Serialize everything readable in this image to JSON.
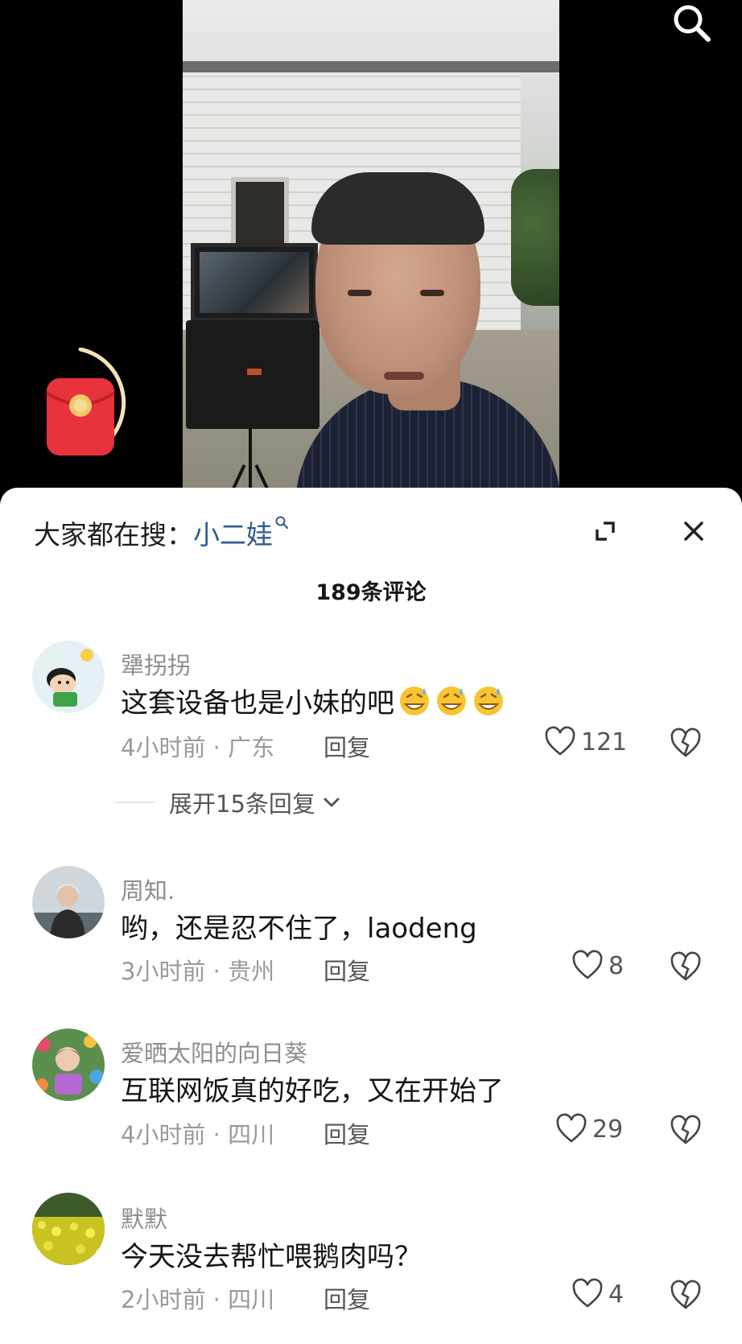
{
  "video": {
    "search_icon": "search-icon",
    "red_packet_icon": "red-packet-icon"
  },
  "sheet": {
    "trend_prefix": "大家都在搜：",
    "trend_term": "小二娃",
    "expand_icon": "expand-icon",
    "close_icon": "close-icon",
    "comment_count": "189条评论"
  },
  "comments": [
    {
      "username": "犟拐拐",
      "text": "这套设备也是小妹的吧",
      "emoji": "sweat-grin-emoji",
      "emoji_count": 3,
      "time_location": "4小时前 · 广东",
      "reply_label": "回复",
      "likes": "121",
      "expand_replies": "展开15条回复"
    },
    {
      "username": "周知.",
      "text": "哟，还是忍不住了，laodeng",
      "time_location": "3小时前 · 贵州",
      "reply_label": "回复",
      "likes": "8"
    },
    {
      "username": "爱晒太阳的向日葵",
      "text": "互联网饭真的好吃，又在开始了",
      "time_location": "4小时前 · 四川",
      "reply_label": "回复",
      "likes": "29"
    },
    {
      "username": "默默",
      "text": "今天没去帮忙喂鹅肉吗？",
      "time_location": "2小时前 · 四川",
      "reply_label": "回复",
      "likes": "4"
    }
  ],
  "colors": {
    "link": "#2f5c8f",
    "text": "#141414",
    "muted": "#9a9a9a",
    "sheet_bg": "#ffffff",
    "backdrop": "#000000",
    "red_packet": "#e8323c"
  }
}
